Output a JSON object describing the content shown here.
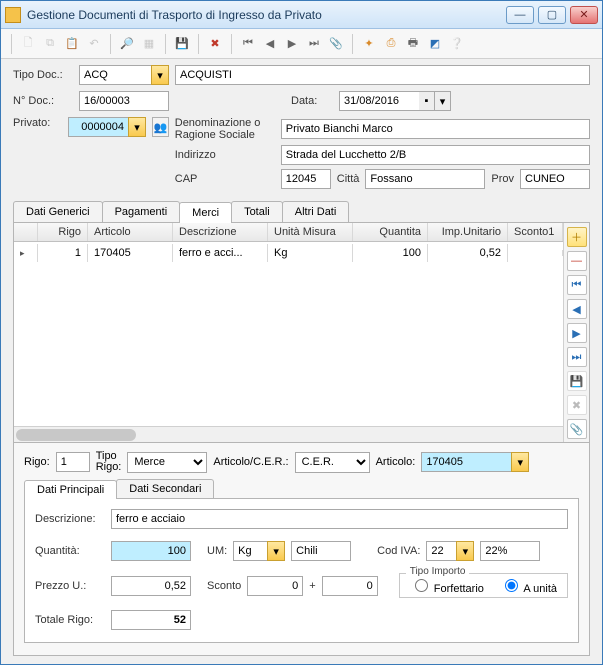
{
  "window": {
    "title": "Gestione Documenti di Trasporto di Ingresso da Privato"
  },
  "header": {
    "tipoDocLabel": "Tipo Doc.:",
    "tipoDocValue": "ACQ",
    "tipoDocDesc": "ACQUISTI",
    "numDocLabel": "N° Doc.:",
    "numDocValue": "16/00003",
    "dataLabel": "Data:",
    "dataValue": "31/08/2016",
    "privatoLabel": "Privato:",
    "privatoValue": "0000004",
    "denomLabel": "Denominazione o Ragione Sociale",
    "denomValue": "Privato Bianchi Marco",
    "indirizzoLabel": "Indirizzo",
    "indirizzoValue": "Strada del Lucchetto 2/B",
    "capLabel": "CAP",
    "capValue": "12045",
    "cittaLabel": "Città",
    "cittaValue": "Fossano",
    "provLabel": "Prov",
    "provValue": "CUNEO"
  },
  "tabs": {
    "t0": "Dati Generici",
    "t1": "Pagamenti",
    "t2": "Merci",
    "t3": "Totali",
    "t4": "Altri Dati"
  },
  "grid": {
    "cols": {
      "rigo": "Rigo",
      "articolo": "Articolo",
      "descrizione": "Descrizione",
      "um": "Unità Misura",
      "quantita": "Quantita",
      "impUnit": "Imp.Unitario",
      "sconto1": "Sconto1"
    },
    "row0": {
      "rigo": "1",
      "articolo": "170405",
      "descrizione": "ferro e acci...",
      "um": "Kg",
      "quantita": "100",
      "impUnit": "0,52",
      "sconto1": ""
    }
  },
  "detail": {
    "rigoLabel": "Rigo:",
    "rigoValue": "1",
    "tipoRigoLabel": "Tipo Rigo:",
    "tipoRigoValue": "Merce",
    "artCerLabel": "Articolo/C.E.R.:",
    "artCerValue": "C.E.R.",
    "articoloLabel": "Articolo:",
    "articoloValue": "170405",
    "tabPrinc": "Dati Principali",
    "tabSec": "Dati Secondari",
    "descrLabel": "Descrizione:",
    "descrValue": "ferro e acciaio",
    "qtaLabel": "Quantità:",
    "qtaValue": "100",
    "umLabel": "UM:",
    "umValue": "Kg",
    "umDesc": "Chili",
    "codIvaLabel": "Cod IVA:",
    "codIvaValue": "22",
    "codIvaDesc": "22%",
    "prezzoLabel": "Prezzo U.:",
    "prezzoValue": "0,52",
    "scontoLabel": "Sconto",
    "scontoValue1": "0",
    "plus": "+",
    "scontoValue2": "0",
    "tipoImportoLabel": "Tipo Importo",
    "radioForf": "Forfettario",
    "radioUnita": "A unità",
    "totaleLabel": "Totale Rigo:",
    "totaleValue": "52"
  }
}
